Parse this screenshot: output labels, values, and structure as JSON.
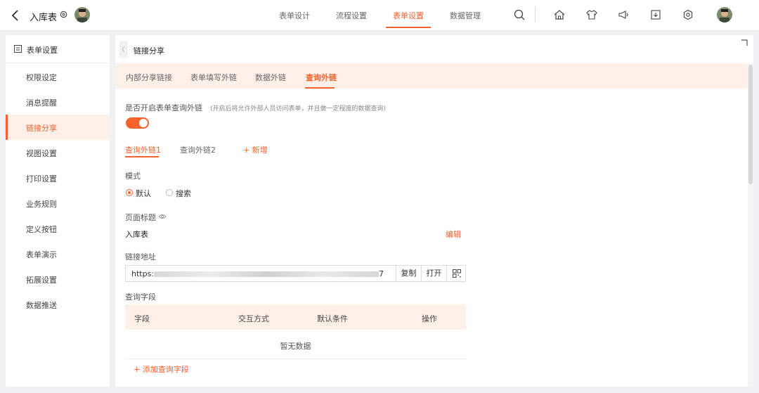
{
  "header": {
    "title": "入库表",
    "nav_tabs": [
      {
        "label": "表单设计"
      },
      {
        "label": "流程设置"
      },
      {
        "label": "表单设置"
      },
      {
        "label": "数据管理"
      }
    ],
    "active_tab": "表单设置",
    "icons": [
      "search-icon",
      "home-icon",
      "tshirt-icon",
      "megaphone-icon",
      "download-icon",
      "settings-icon"
    ]
  },
  "sidebar": {
    "title": "表单设置",
    "items": [
      {
        "label": "权限设定"
      },
      {
        "label": "消息提醒"
      },
      {
        "label": "链接分享"
      },
      {
        "label": "视图设置"
      },
      {
        "label": "打印设置"
      },
      {
        "label": "业务规则"
      },
      {
        "label": "定义按钮"
      },
      {
        "label": "表单演示"
      },
      {
        "label": "拓展设置"
      },
      {
        "label": "数据推送"
      }
    ],
    "active_item": "链接分享"
  },
  "main": {
    "title": "链接分享",
    "subtabs": [
      {
        "label": "内部分享链接"
      },
      {
        "label": "表单填写外链"
      },
      {
        "label": "数据外链"
      },
      {
        "label": "查询外链"
      }
    ],
    "active_subtab": "查询外链",
    "enable_label": "是否开启表单查询外链",
    "enable_hint": "(开启后将允许外部人员访问表单，并且做一定程度的数据查询)",
    "enabled": true,
    "query_tabs": [
      {
        "label": "查询外链1"
      },
      {
        "label": "查询外链2"
      }
    ],
    "add_tab_label": "+ 新增",
    "mode_label": "模式",
    "mode_options": [
      {
        "label": "默认",
        "selected": true
      },
      {
        "label": "搜索",
        "selected": false
      }
    ],
    "page_title_label": "页面标题",
    "page_title_value": "入库表",
    "edit_label": "编辑",
    "link_label": "链接地址",
    "link_prefix": "https:",
    "link_suffix": "7",
    "copy_label": "复制",
    "open_label": "打开",
    "query_fields_label": "查询字段",
    "table_headers": [
      "字段",
      "交互方式",
      "默认条件",
      "操作"
    ],
    "empty_text": "暂无数据",
    "add_field_label": "+ 添加查询字段"
  },
  "colors": {
    "accent": "#f5622d",
    "accent_bg": "#fdf0e9"
  }
}
